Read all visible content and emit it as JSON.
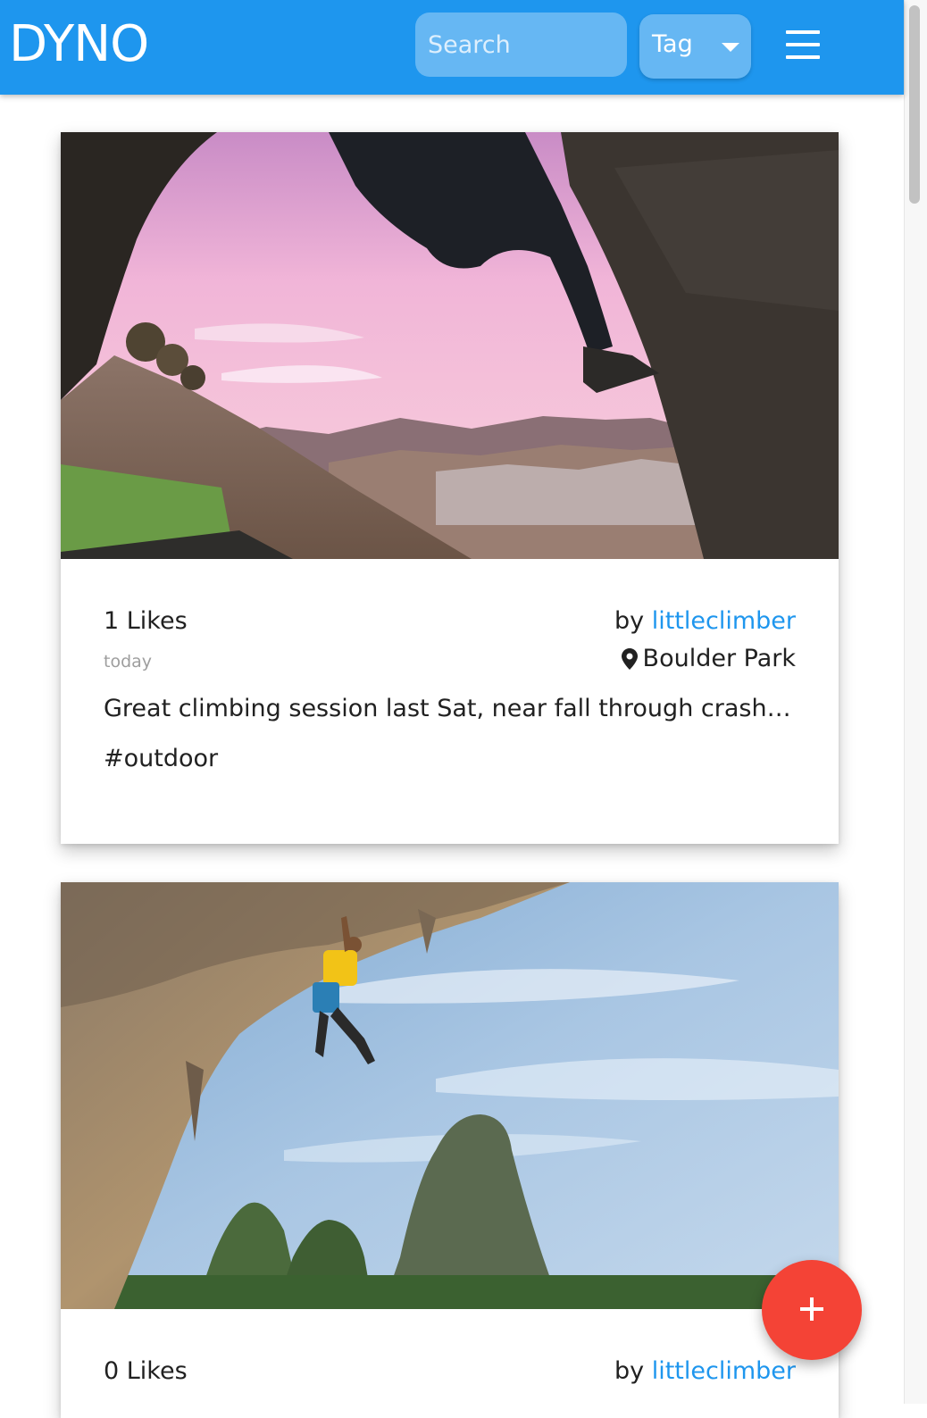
{
  "header": {
    "brand": "DYNO",
    "search_placeholder": "Search",
    "tag_filter_label": "Tag",
    "accent_color": "#1e96ee"
  },
  "icons": {
    "menu": "hamburger-menu-icon",
    "caret": "caret-down-icon",
    "location": "map-pin-icon",
    "add": "plus-icon"
  },
  "posts": [
    {
      "likes_label": "1 Likes",
      "by_prefix": "by",
      "author": "littleclimber",
      "date": "today",
      "location": "Boulder Park",
      "caption": "Great climbing session last Sat, near fall through crash ma...",
      "hashtag": "#outdoor",
      "photo_subject": "boulderer on overhanging rock at sunset"
    },
    {
      "likes_label": "0 Likes",
      "by_prefix": "by",
      "author": "littleclimber",
      "photo_subject": "climber on overhanging cliff above limestone peaks"
    }
  ],
  "fab_color": "#f44336"
}
